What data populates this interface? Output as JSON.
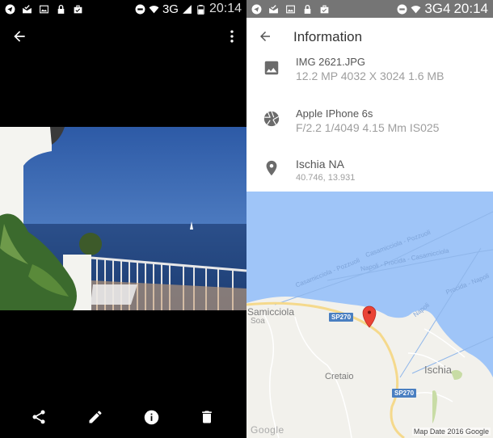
{
  "left_screen": {
    "statusbar": {
      "left_icons": [
        "telegram-icon",
        "mail-check-icon",
        "image-icon",
        "lock-icon",
        "briefcase-check-icon"
      ],
      "right_icons": [
        "do-not-disturb-icon",
        "wifi-icon",
        "signal-icon",
        "battery-icon"
      ],
      "network": "3G",
      "time": "20:14"
    },
    "toolbar": {
      "back_icon": "arrow-back-icon",
      "menu_icon": "more-vert-icon"
    },
    "photo": {
      "description": "Sea view from terrace with white railing, blue sky and sailboat"
    },
    "bottom_actions": [
      {
        "name": "share",
        "icon": "share-icon"
      },
      {
        "name": "edit",
        "icon": "pencil-icon"
      },
      {
        "name": "info",
        "icon": "info-icon"
      },
      {
        "name": "delete",
        "icon": "trash-icon"
      }
    ]
  },
  "right_screen": {
    "statusbar": {
      "network": "3G4",
      "time": "20:14"
    },
    "header": {
      "title": "Information",
      "back_icon": "arrow-back-icon"
    },
    "details": [
      {
        "icon": "image-icon",
        "primary": "IMG  2621.JPG",
        "secondary": "12.2 MP 4032 X 3024 1.6 MB"
      },
      {
        "icon": "aperture-icon",
        "primary": "Apple IPhone 6s",
        "secondary": "F/2.2 1/4049 4.15 Mm IS025"
      },
      {
        "icon": "location-pin-icon",
        "primary": "Ischia NA",
        "secondary": "40.746, 13.931"
      }
    ],
    "map": {
      "labels": {
        "route1": "Casamicciola - Pozzuoli",
        "route2": "Casamicciola - Pozzuoli",
        "route3": "Napoli - Procida - Casamicciola",
        "route4": "Procida - Napoli",
        "route5": "Napoli",
        "town1": "Samicciola",
        "town1b": "Soa",
        "town2": "Cretaio",
        "town3": "Ischia"
      },
      "road_shields": [
        "SP270",
        "SP270"
      ],
      "logo": "Google",
      "attribution": "Map Date 2016 Google",
      "colors": {
        "water": "#9fc5f8",
        "land": "#f2f1ec",
        "road": "#f5d98c",
        "marker": "#ea4335",
        "park": "#c8dca5"
      }
    }
  }
}
